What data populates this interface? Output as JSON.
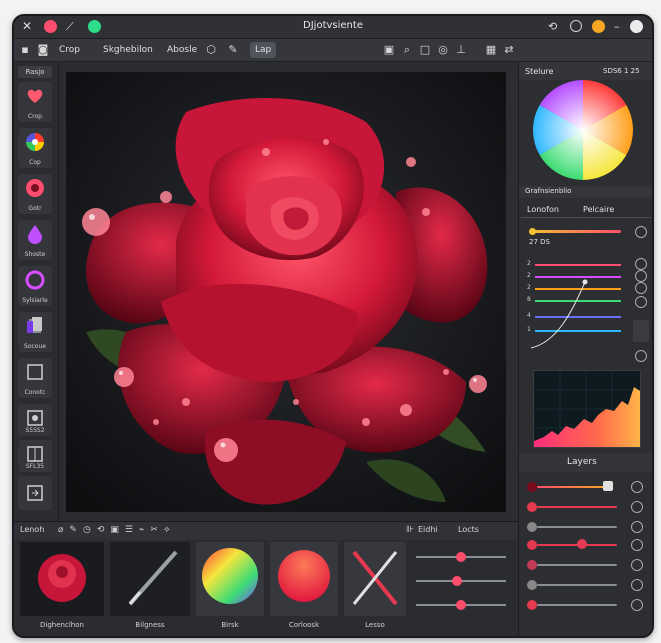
{
  "window": {
    "title": "DJjotvsiente"
  },
  "toolbar": {
    "crop": "Crop",
    "sketch": "Skghebilon",
    "absolute": "Abosle",
    "lap": "Lap"
  },
  "sidebar": {
    "header": "Rasjo",
    "items": [
      {
        "label": "Crop",
        "icon": "heart-icon"
      },
      {
        "label": "Cop",
        "icon": "color-wheel-icon"
      },
      {
        "label": "Gotr",
        "icon": "lens-icon"
      },
      {
        "label": "Shoste",
        "icon": "drop-icon"
      },
      {
        "label": "Sylsiarle",
        "icon": "ring-icon"
      },
      {
        "label": "Socoue",
        "icon": "layer-icon"
      },
      {
        "label": "Conotc",
        "icon": "square-icon"
      },
      {
        "label": "S5SS2",
        "icon": "eye-icon"
      },
      {
        "label": "SFL35",
        "icon": "grid-icon"
      },
      {
        "label": "",
        "icon": "export-icon"
      }
    ]
  },
  "right": {
    "stelure": "Stelure",
    "code": "SDS6 1 25",
    "gradient_header": "Grafnsienblio",
    "tab1": "Lonofon",
    "tab2": "Pelcaire",
    "value": "27 DS",
    "layers_title": "Layers"
  },
  "curves": {
    "levels": [
      "2",
      "2",
      "2",
      "8",
      "4",
      "1"
    ]
  },
  "bottom": {
    "bar_left": "Lenoh",
    "bar_mid": "Eidhi",
    "bar_right": "Locts",
    "thumbs": [
      "Dighenclhon",
      "Bilgness",
      "Birsk",
      "Corloosk",
      "Lesso"
    ]
  },
  "colors": {
    "accent": "#ff4d6d",
    "panel": "#2c2e32",
    "bg": "#141517"
  }
}
